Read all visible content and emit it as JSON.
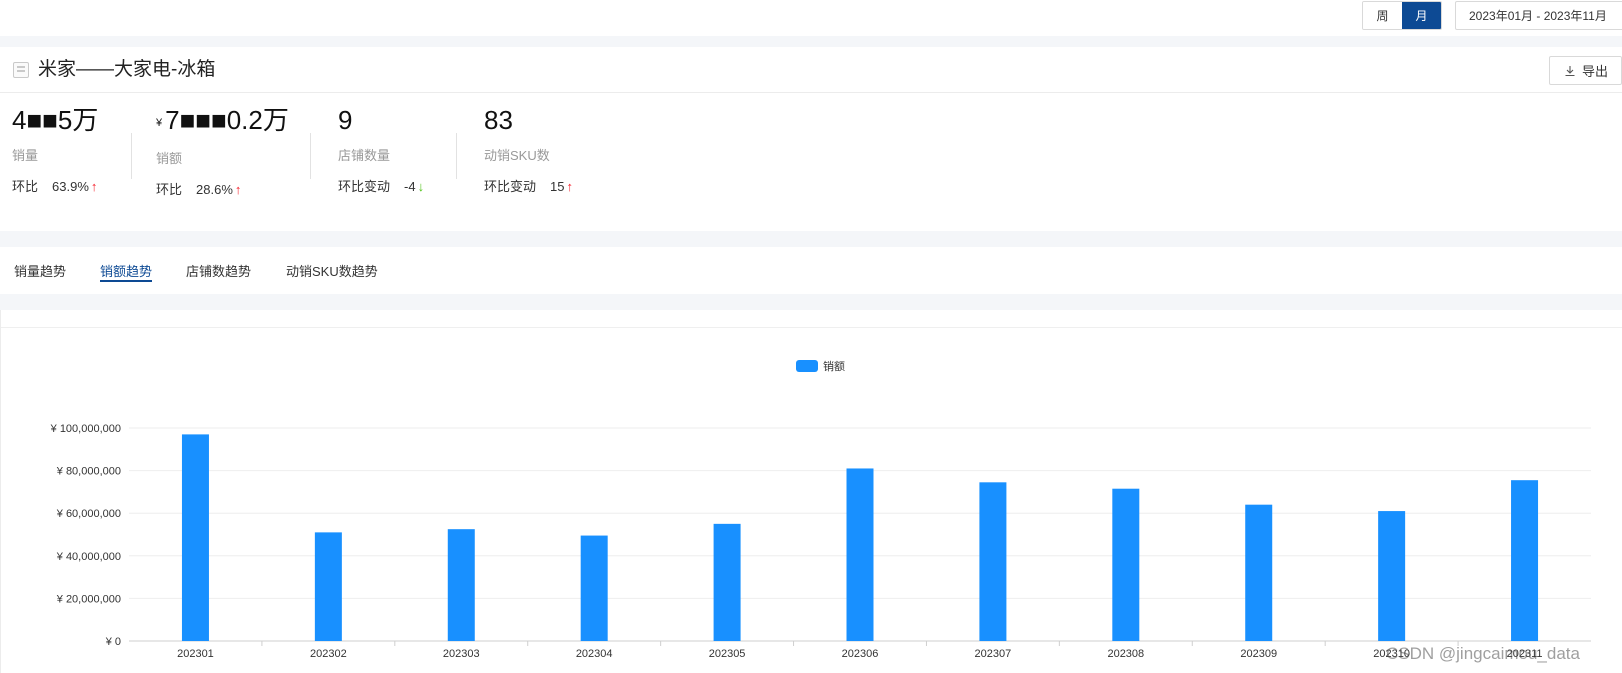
{
  "header": {
    "period_week": "周",
    "period_month": "月",
    "date_range": "2023年01月 - 2023年11月"
  },
  "summary": {
    "title": "米家——大家电-冰箱",
    "export_label": "导出",
    "metrics": [
      {
        "value": "4■■5万",
        "currency": "",
        "label": "销量",
        "change_label": "环比",
        "change_value": "63.9%",
        "direction": "up"
      },
      {
        "value": "7■■■0.2万",
        "currency": "¥",
        "label": "销额",
        "change_label": "环比",
        "change_value": "28.6%",
        "direction": "up"
      },
      {
        "value": "9",
        "currency": "",
        "label": "店铺数量",
        "change_label": "环比变动",
        "change_value": "-4",
        "direction": "down"
      },
      {
        "value": "83",
        "currency": "",
        "label": "动销SKU数",
        "change_label": "环比变动",
        "change_value": "15",
        "direction": "up"
      }
    ]
  },
  "tabs": [
    {
      "label": "销量趋势",
      "active": false
    },
    {
      "label": "销额趋势",
      "active": true
    },
    {
      "label": "店铺数趋势",
      "active": false
    },
    {
      "label": "动销SKU数趋势",
      "active": false
    }
  ],
  "chart_data": {
    "type": "bar",
    "categories": [
      "202301",
      "202302",
      "202303",
      "202304",
      "202305",
      "202306",
      "202307",
      "202308",
      "202309",
      "202310",
      "202311"
    ],
    "series": [
      {
        "name": "销额",
        "values": [
          97000000,
          51000000,
          52500000,
          49500000,
          55000000,
          81000000,
          74500000,
          71500000,
          64000000,
          61000000,
          75500000
        ],
        "color": "#1890ff"
      }
    ],
    "yticks": [
      "¥ 0",
      "¥ 20,000,000",
      "¥ 40,000,000",
      "¥ 60,000,000",
      "¥ 80,000,000",
      "¥ 100,000,000"
    ],
    "ylim": [
      0,
      100000000
    ],
    "legend": "top-center",
    "grid": true
  },
  "watermark": "CSDN @jingcaimou_data"
}
